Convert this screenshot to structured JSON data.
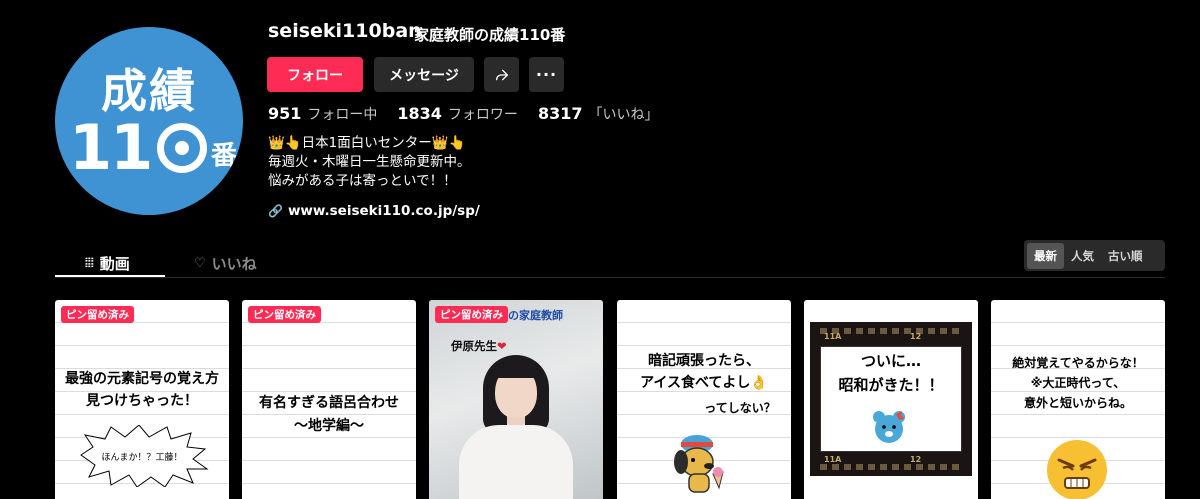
{
  "profile": {
    "avatar_line1": "成績",
    "avatar_line2": "11",
    "avatar_ban": "番",
    "username": "seiseki110ban",
    "display_name": "家庭教師の成績110番"
  },
  "actions": {
    "follow_label": "フォロー",
    "message_label": "メッセージ",
    "more_label": "···"
  },
  "stats": [
    {
      "value": "951",
      "label": "フォロー中"
    },
    {
      "value": "1834",
      "label": "フォロワー"
    },
    {
      "value": "8317",
      "label": "「いいね」"
    }
  ],
  "bio": {
    "lines": [
      "👑👆日本1面白いセンター👑👆",
      "毎週火・木曜日一生懸命更新中。",
      "悩みがある子は寄っといで！！"
    ],
    "link": "www.seiseki110.co.jp/sp/"
  },
  "tabs": {
    "videos": "動画",
    "likes": "いいね"
  },
  "sort": {
    "options": [
      "最新",
      "人気",
      "古い順"
    ],
    "active": "最新"
  },
  "videos": [
    {
      "pinned": "ピン留め済み",
      "title_lines": [
        "最強の元素記号の覚え方",
        "見つけちゃった！"
      ],
      "bubble": "ほんまか！？工藤！"
    },
    {
      "pinned": "ピン留め済み",
      "title_lines": [
        "有名すぎる語呂合わせ",
        "〜地学編〜"
      ]
    },
    {
      "pinned": "ピン留め済み",
      "top_text": "森の家庭教師",
      "name": "伊原先生"
    },
    {
      "title_lines": [
        "暗記頑張ったら、",
        "アイス食べてよし👌"
      ],
      "sub": "ってしない？"
    },
    {
      "title_lines": [
        "ついに…",
        "昭和がきた！！"
      ],
      "film_num_left": "11A",
      "film_num_right": "12"
    },
    {
      "title_lines": [
        "絶対覚えてやるからな！",
        "※大正時代って、",
        "意外と短いからね。"
      ]
    }
  ],
  "colors": {
    "accent": "#fe2c55",
    "avatar_bg": "#3f93d2",
    "button_bg": "#2a2a2a"
  }
}
